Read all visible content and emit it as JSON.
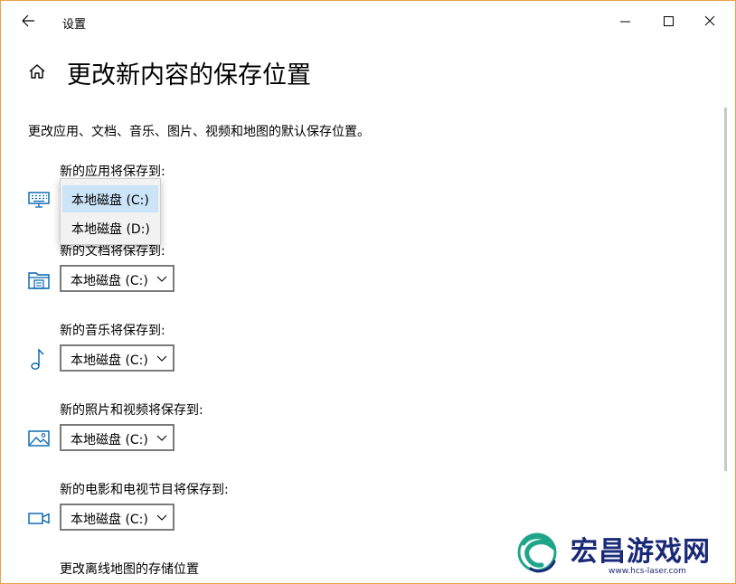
{
  "app_title": "设置",
  "page_title": "更改新内容的保存位置",
  "description": "更改应用、文档、音乐、图片、视频和地图的默认保存位置。",
  "groups": [
    {
      "label": "新的应用将保存到:",
      "icon": "keyboard-icon",
      "value": "本地磁盘 (C:)"
    },
    {
      "label": "新的文档将保存到:",
      "icon": "folder-icon",
      "value": "本地磁盘 (C:)"
    },
    {
      "label": "新的音乐将保存到:",
      "icon": "music-note-icon",
      "value": "本地磁盘 (C:)"
    },
    {
      "label": "新的照片和视频将保存到:",
      "icon": "picture-icon",
      "value": "本地磁盘 (C:)"
    },
    {
      "label": "新的电影和电视节目将保存到:",
      "icon": "video-camera-icon",
      "value": "本地磁盘 (C:)"
    }
  ],
  "offline_maps_label": "更改离线地图的存储位置",
  "dropdown_options": [
    "本地磁盘 (C:)",
    "本地磁盘 (D:)"
  ],
  "selected_option": "本地磁盘 (C:)",
  "watermark": {
    "name": "宏昌游戏网",
    "url": "www.hcs-laser.com"
  },
  "colors": {
    "accent": "#0063b1",
    "selected_option_bg": "#cce4f7",
    "frame_border": "#e8a24a",
    "watermark_text": "#1b2a78",
    "watermark_logo": "#1fa58a"
  }
}
